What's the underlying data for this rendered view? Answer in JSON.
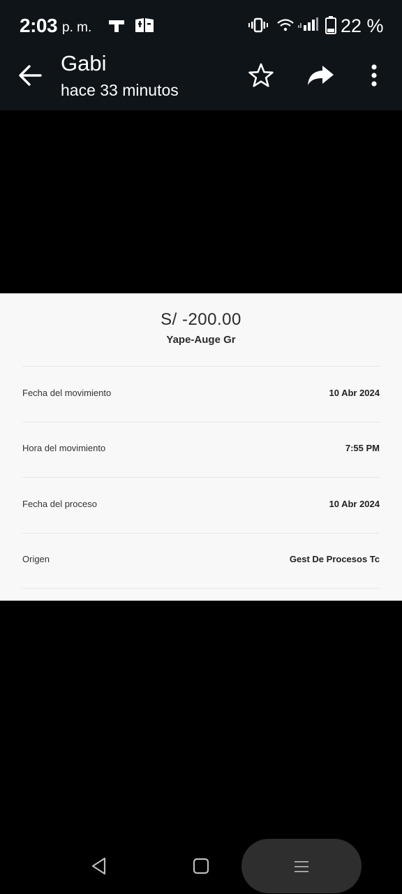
{
  "status_bar": {
    "time": "2:03",
    "am_pm": "p. m.",
    "battery_percent": "22 %",
    "icons": [
      "notification-t-icon",
      "notification-app-icon",
      "vibrate-icon",
      "wifi-icon",
      "signal-icon",
      "battery-icon"
    ]
  },
  "app_bar": {
    "back_icon": "arrow-left-icon",
    "title": "Gabi",
    "subtitle": "hace 33 minutos",
    "actions": [
      "star-icon",
      "share-icon",
      "more-vert-icon"
    ]
  },
  "receipt": {
    "amount": "S/ -200.00",
    "merchant": "Yape-Auge Gr",
    "rows": [
      {
        "label": "Fecha del movimiento",
        "value": "10 Abr 2024"
      },
      {
        "label": "Hora del movimiento",
        "value": "7:55 PM"
      },
      {
        "label": "Fecha del proceso",
        "value": "10 Abr 2024"
      },
      {
        "label": "Origen",
        "value": "Gest De Procesos Tc"
      }
    ]
  },
  "nav_bar": {
    "icons": [
      "nav-back-icon",
      "nav-home-icon",
      "nav-recents-icon"
    ]
  },
  "colors": {
    "bar_background": "#0f1419",
    "media_background": "#000000",
    "receipt_background": "#f8f8f8",
    "text_dark": "#2b2b2b"
  }
}
